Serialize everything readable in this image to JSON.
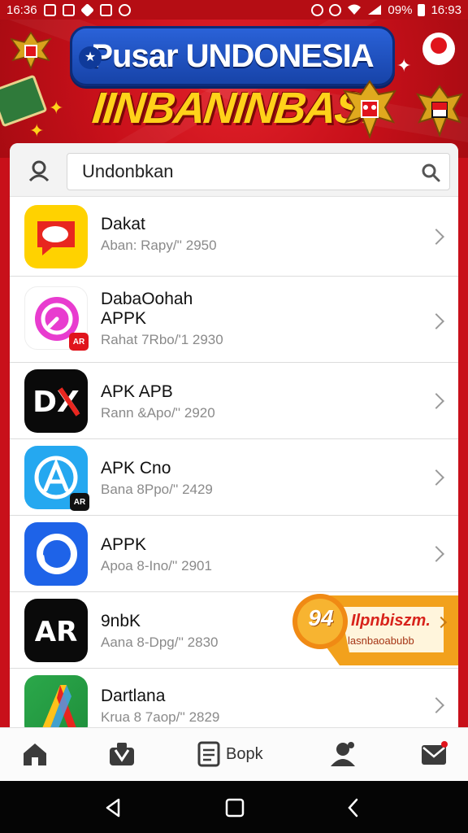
{
  "status_bar": {
    "time_left": "16:36",
    "battery": "09%",
    "time_right": "16:93"
  },
  "banner": {
    "title": "Pusar UNDONESIA",
    "subtitle": "IINBANINBAS!"
  },
  "search": {
    "value": "Undonbkan"
  },
  "apps": [
    {
      "name": "Dakat",
      "meta": "Aban: Rapy/'' 2950",
      "icon": "chat-bubble-icon",
      "colors": [
        "#ffd200",
        "#e8261f"
      ]
    },
    {
      "name": "DabaOohah\nAPPK",
      "meta": "Rahat 7Rbo/'1 2930",
      "icon": "timer-icon",
      "colors": [
        "#ffffff",
        "#e83ccf"
      ],
      "badge": "AR"
    },
    {
      "name": "APK APB",
      "meta": "Rann &Apo/'' 2920",
      "icon": "dx-icon",
      "colors": [
        "#0a0a0a",
        "#ffffff"
      ]
    },
    {
      "name": "APK Cno",
      "meta": "Bana 8Ppo/'' 2429",
      "icon": "app-store-icon",
      "colors": [
        "#25a8f0",
        "#ffffff"
      ],
      "badge": "AR"
    },
    {
      "name": "APPK",
      "meta": "Apoa 8-Ino/'' 2901",
      "icon": "ring-icon",
      "colors": [
        "#1e63e8",
        "#ffffff"
      ]
    },
    {
      "name": "9nbK",
      "meta": "Aana 8-Dpg/'' 2830",
      "icon": "ar-icon",
      "colors": [
        "#0a0a0a",
        "#ffffff"
      ]
    },
    {
      "name": "Dartlana",
      "meta": "Krua 8 7aop/'' 2829",
      "icon": "triangle-icon",
      "colors": [
        "#2ba84a",
        "#ffc21a"
      ]
    }
  ],
  "promo": {
    "badge": "94",
    "headline": "Ilpnbiszm.",
    "sub": "lasnbaoabubb"
  },
  "bottom_nav": {
    "items": [
      "home-icon",
      "store-icon",
      "book-icon",
      "profile-icon",
      "mail-icon"
    ],
    "book_label": "Bopk"
  }
}
